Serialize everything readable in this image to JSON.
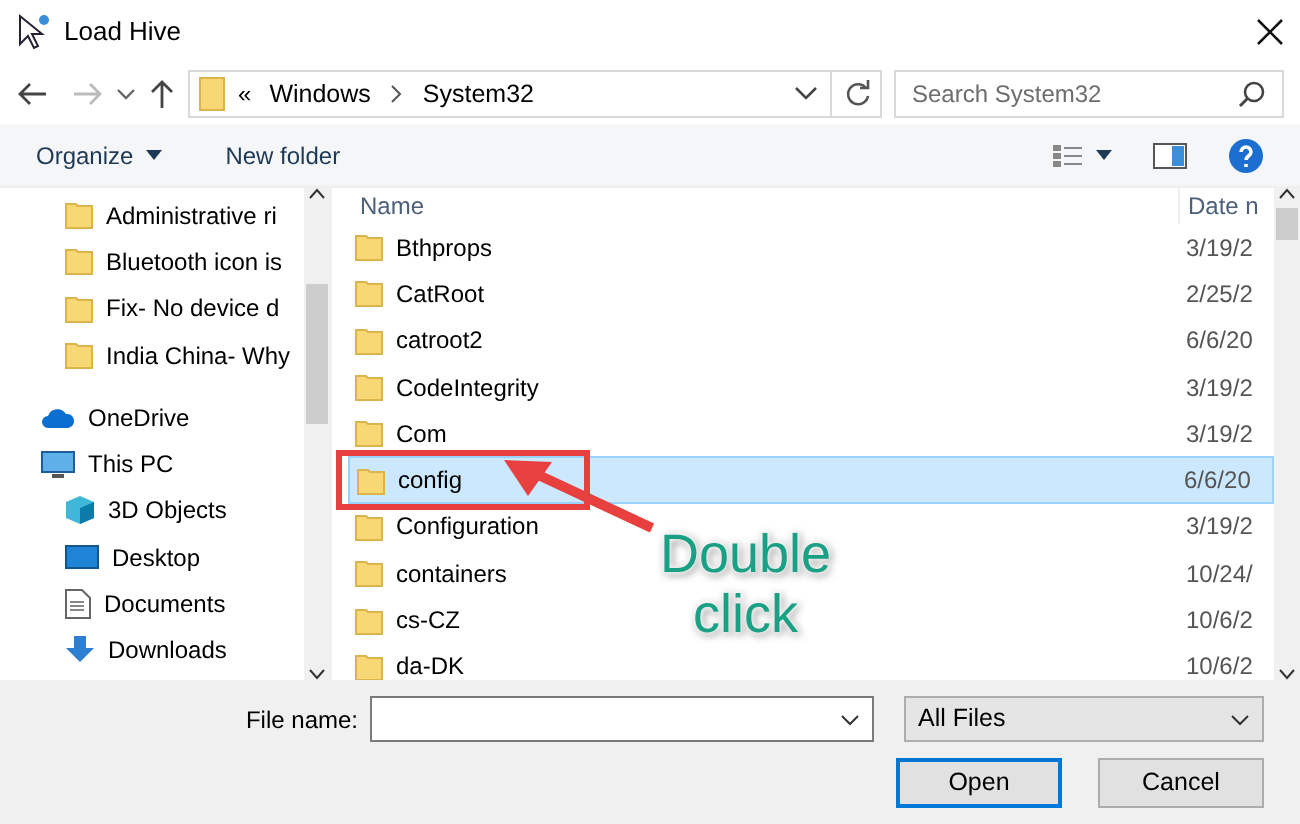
{
  "window": {
    "title": "Load Hive"
  },
  "address_bar": {
    "overflow": "«",
    "path": [
      "Windows",
      "System32"
    ]
  },
  "search": {
    "placeholder": "Search System32"
  },
  "toolbar": {
    "buttons": [
      "Organize",
      "New folder"
    ]
  },
  "sidebar": {
    "items": [
      {
        "label": "Administrative ri",
        "kind": "folder"
      },
      {
        "label": "Bluetooth icon is",
        "kind": "folder"
      },
      {
        "label": "Fix- No device d",
        "kind": "folder"
      },
      {
        "label": "India China- Why",
        "kind": "folder"
      },
      {
        "label": "OneDrive",
        "kind": "cloud"
      },
      {
        "label": "This PC",
        "kind": "pc"
      },
      {
        "label": "3D Objects",
        "kind": "cube"
      },
      {
        "label": "Desktop",
        "kind": "desktop"
      },
      {
        "label": "Documents",
        "kind": "document"
      },
      {
        "label": "Downloads",
        "kind": "download"
      }
    ]
  },
  "file_list": {
    "columns": [
      "Name",
      "Date n"
    ],
    "rows": [
      {
        "name": "Bthprops",
        "date": "3/19/2",
        "selected": false
      },
      {
        "name": "CatRoot",
        "date": "2/25/2",
        "selected": false
      },
      {
        "name": "catroot2",
        "date": "6/6/20",
        "selected": false
      },
      {
        "name": "CodeIntegrity",
        "date": "3/19/2",
        "selected": false
      },
      {
        "name": "Com",
        "date": "3/19/2",
        "selected": false
      },
      {
        "name": "config",
        "date": "6/6/20",
        "selected": true
      },
      {
        "name": "Configuration",
        "date": "3/19/2",
        "selected": false
      },
      {
        "name": "containers",
        "date": "10/24/",
        "selected": false
      },
      {
        "name": "cs-CZ",
        "date": "10/6/2",
        "selected": false
      },
      {
        "name": "da-DK",
        "date": "10/6/2",
        "selected": false
      }
    ]
  },
  "annotation": {
    "lines": [
      "Double",
      "click"
    ]
  },
  "file_name": {
    "label": "File name:"
  },
  "file_type": {
    "value": "All Files"
  },
  "buttons": [
    {
      "label": "Open",
      "default": true
    },
    {
      "label": "Cancel",
      "default": false
    }
  ]
}
